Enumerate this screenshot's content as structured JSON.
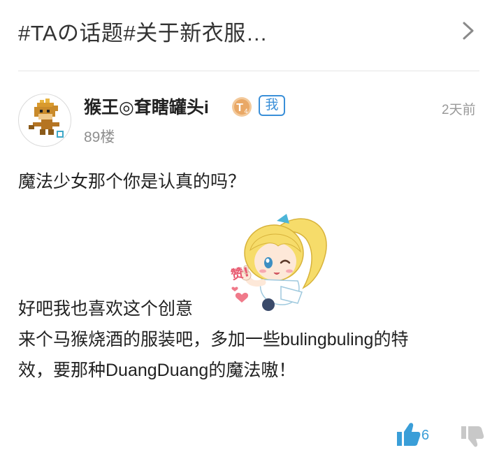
{
  "topic": {
    "title": "#TAの话题#关于新衣服…"
  },
  "post": {
    "username": "猴王◎耷瞎罐头i",
    "level_badge": "T4",
    "me_badge": "我",
    "timestamp": "2天前",
    "floor": "89楼",
    "lines": [
      "魔法少女那个你是认真的吗？",
      "好吧我也喜欢这个创意",
      "来个马猴烧酒的服装吧，多加一些bulingbuling的特",
      "效，要那种DuangDuang的魔法嗷！"
    ],
    "sticker": {
      "icon": "chibi-girl-thumbs-up-sticker",
      "text": "赞!"
    }
  },
  "actions": {
    "like_count": "6",
    "like_color": "#3a9ed8",
    "dislike_color": "#c8c8c8"
  }
}
